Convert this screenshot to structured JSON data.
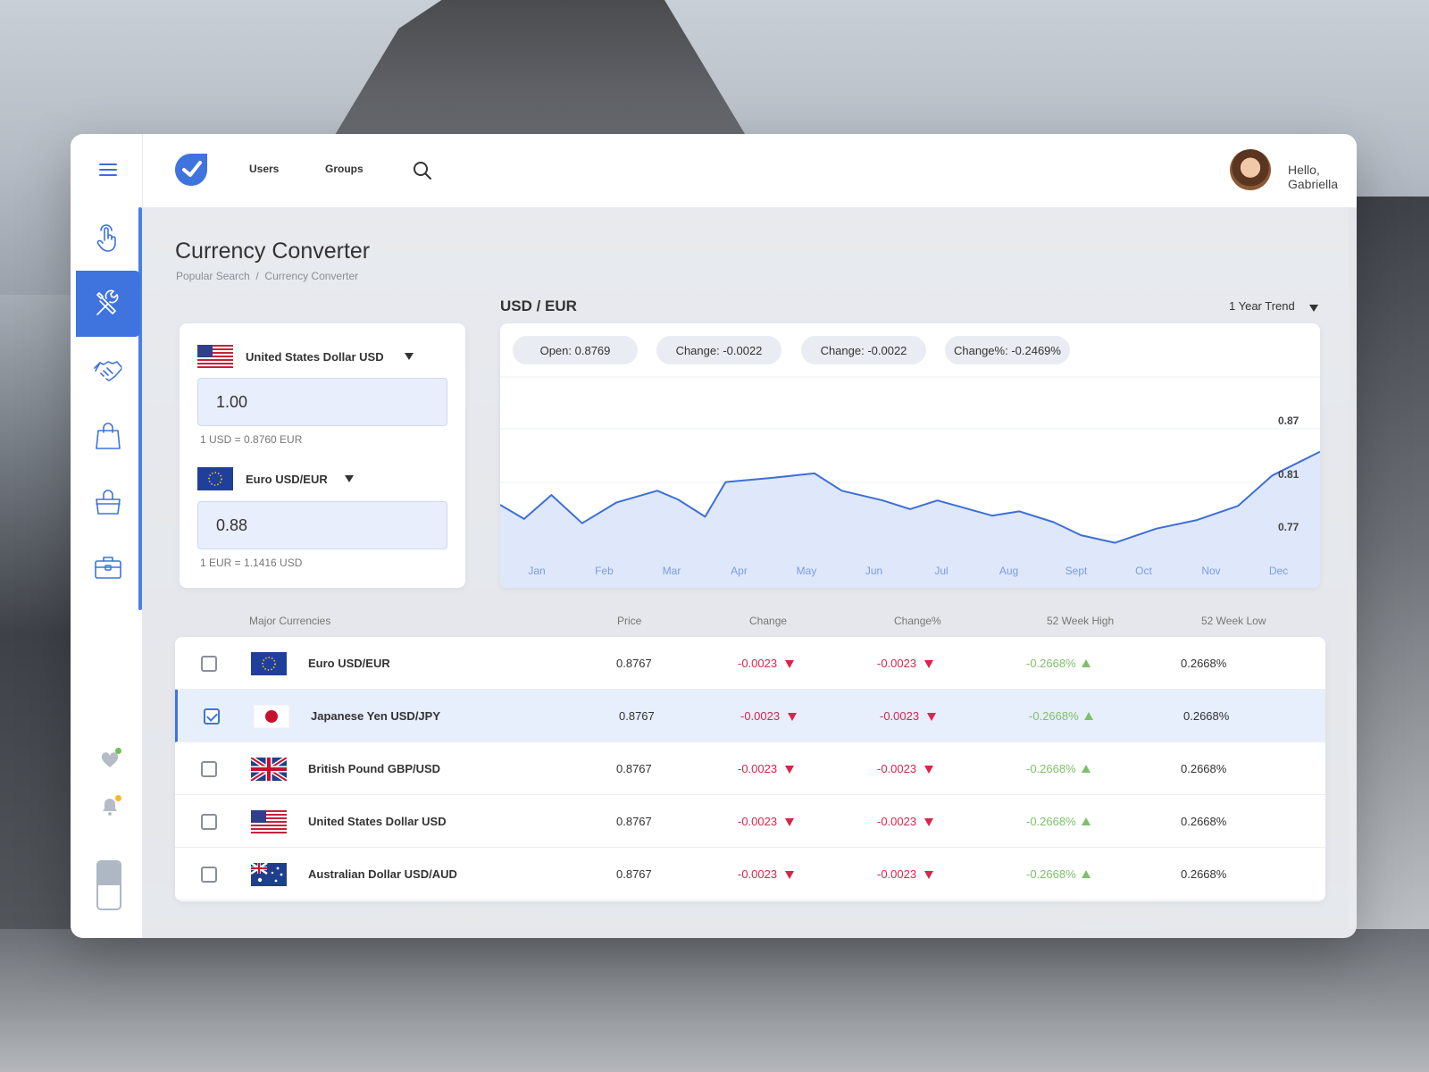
{
  "topbar": {
    "nav": [
      "Users",
      "Groups"
    ],
    "user_greeting": "Hello, Gabriella"
  },
  "sidebar": {
    "items": [
      {
        "icon": "touch-icon"
      },
      {
        "icon": "tools-icon",
        "active": true
      },
      {
        "icon": "handshake-icon"
      },
      {
        "icon": "shopping-bag-icon"
      },
      {
        "icon": "shopping-basket-icon"
      },
      {
        "icon": "briefcase-icon"
      }
    ],
    "bottom_icons": [
      "heart-icon",
      "bell-icon"
    ]
  },
  "page": {
    "title": "Currency Converter",
    "breadcrumb": [
      "Popular Search",
      "/",
      "Currency Converter"
    ]
  },
  "converter": {
    "from_currency": "United States Dollar USD",
    "from_amount": "1.00",
    "from_rate": "1 USD = 0.8760 EUR",
    "to_currency": "Euro USD/EUR",
    "to_amount": "0.88",
    "to_rate": "1 EUR = 1.1416 USD"
  },
  "chart": {
    "title": "USD / EUR",
    "range_select": "1 Year Trend",
    "stats": [
      "Open: 0.8769",
      "Change: -0.0022",
      "Change: -0.0022",
      "Change%: -0.2469%"
    ]
  },
  "chart_data": {
    "type": "area",
    "x": [
      "Jan",
      "Feb",
      "Mar",
      "Apr",
      "May",
      "Jun",
      "Jul",
      "Aug",
      "Sept",
      "Oct",
      "Nov",
      "Dec"
    ],
    "ytick_labels": [
      "0.87",
      "0.81",
      "0.77"
    ],
    "ylim": [
      0.75,
      0.89
    ],
    "grid": true,
    "series": [
      {
        "values": [
          0.801,
          0.788,
          0.81,
          0.784,
          0.803,
          0.814,
          0.806,
          0.79,
          0.822,
          0.826,
          0.83,
          0.814,
          0.805,
          0.797,
          0.805,
          0.798,
          0.791,
          0.795,
          0.785,
          0.773,
          0.766,
          0.779,
          0.787,
          0.8,
          0.828,
          0.85
        ],
        "x_positions": [
          0,
          0.35,
          0.75,
          1.2,
          1.7,
          2.3,
          2.6,
          3.0,
          3.3,
          4.0,
          4.6,
          5.0,
          5.6,
          6.0,
          6.4,
          6.8,
          7.2,
          7.6,
          8.1,
          8.5,
          9.0,
          9.6,
          10.2,
          10.8,
          11.3,
          12
        ]
      }
    ]
  },
  "table": {
    "headers": [
      "Major Currencies",
      "Price",
      "Change",
      "Change%",
      "52 Week High",
      "52 Week Low"
    ],
    "rows": [
      {
        "name": "Euro USD/EUR",
        "price": "0.8767",
        "change": "-0.0023",
        "change_pct": "-0.0023",
        "high": "-0.2668%",
        "low": "0.2668%",
        "checked": false,
        "flag": "eu-flag"
      },
      {
        "name": "Japanese Yen USD/JPY",
        "price": "0.8767",
        "change": "-0.0023",
        "change_pct": "-0.0023",
        "high": "-0.2668%",
        "low": "0.2668%",
        "checked": true,
        "flag": "jp-flag"
      },
      {
        "name": "British Pound GBP/USD",
        "price": "0.8767",
        "change": "-0.0023",
        "change_pct": "-0.0023",
        "high": "-0.2668%",
        "low": "0.2668%",
        "checked": false,
        "flag": "uk-flag"
      },
      {
        "name": "United States Dollar USD",
        "price": "0.8767",
        "change": "-0.0023",
        "change_pct": "-0.0023",
        "high": "-0.2668%",
        "low": "0.2668%",
        "checked": false,
        "flag": "us-flag"
      },
      {
        "name": "Australian Dollar USD/AUD",
        "price": "0.8767",
        "change": "-0.0023",
        "change_pct": "-0.0023",
        "high": "-0.2668%",
        "low": "0.2668%",
        "checked": false,
        "flag": "au-flag"
      }
    ]
  },
  "colors": {
    "accent": "#3f73de",
    "negative": "#d6264a",
    "positive": "#7ec06a",
    "chart_fill": "#dbe5fb",
    "chart_line": "#3d6fd6"
  }
}
